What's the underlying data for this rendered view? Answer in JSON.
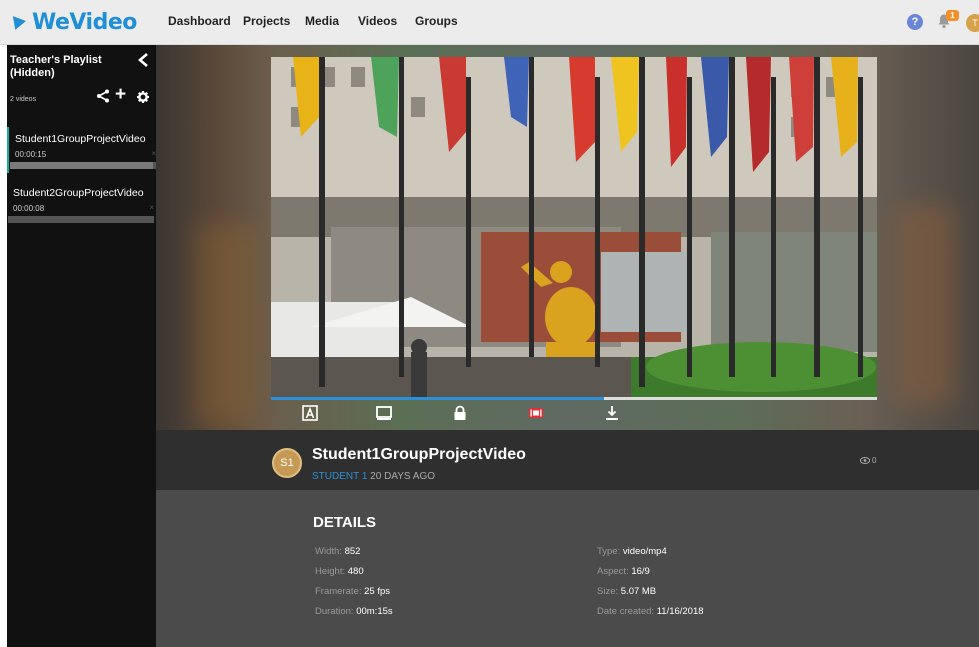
{
  "app": {
    "logo_text": "WeVideo",
    "nav": [
      "Dashboard",
      "Projects",
      "Media",
      "Videos",
      "Groups"
    ],
    "notification_count": "1",
    "user_initial": "T"
  },
  "playlist": {
    "title": "Teacher's Playlist (Hidden)",
    "count": "2 videos",
    "items": [
      {
        "name": "Student1GroupProjectVideo",
        "duration": "00:00:15",
        "remove": "×",
        "progress": 0.98
      },
      {
        "name": "Student2GroupProjectVideo",
        "duration": "00:00:08",
        "remove": "×",
        "progress": 0
      }
    ]
  },
  "player": {
    "progress": 0.55,
    "controls": [
      "annotate-icon",
      "screen-icon",
      "lock-icon",
      "captions-icon",
      "download-icon"
    ]
  },
  "video": {
    "title": "Student1GroupProjectVideo",
    "author": "STUDENT 1",
    "age": "20 DAYS AGO",
    "author_initials": "S1",
    "views": "0"
  },
  "details": {
    "title": "DETAILS",
    "left": [
      {
        "label": "Width:",
        "value": "852"
      },
      {
        "label": "Height:",
        "value": "480"
      },
      {
        "label": "Framerate:",
        "value": "25 fps"
      },
      {
        "label": "Duration:",
        "value": "00m:15s"
      }
    ],
    "right": [
      {
        "label": "Type:",
        "value": "video/mp4"
      },
      {
        "label": "Aspect:",
        "value": "16/9"
      },
      {
        "label": "Size:",
        "value": "5.07 MB"
      },
      {
        "label": "Date created:",
        "value": "11/16/2018"
      }
    ]
  },
  "colors": {
    "accent": "#2c8fd8",
    "brand": "#1f8fd6",
    "badge": "#f2902b",
    "active_marker": "#15b0a0"
  }
}
